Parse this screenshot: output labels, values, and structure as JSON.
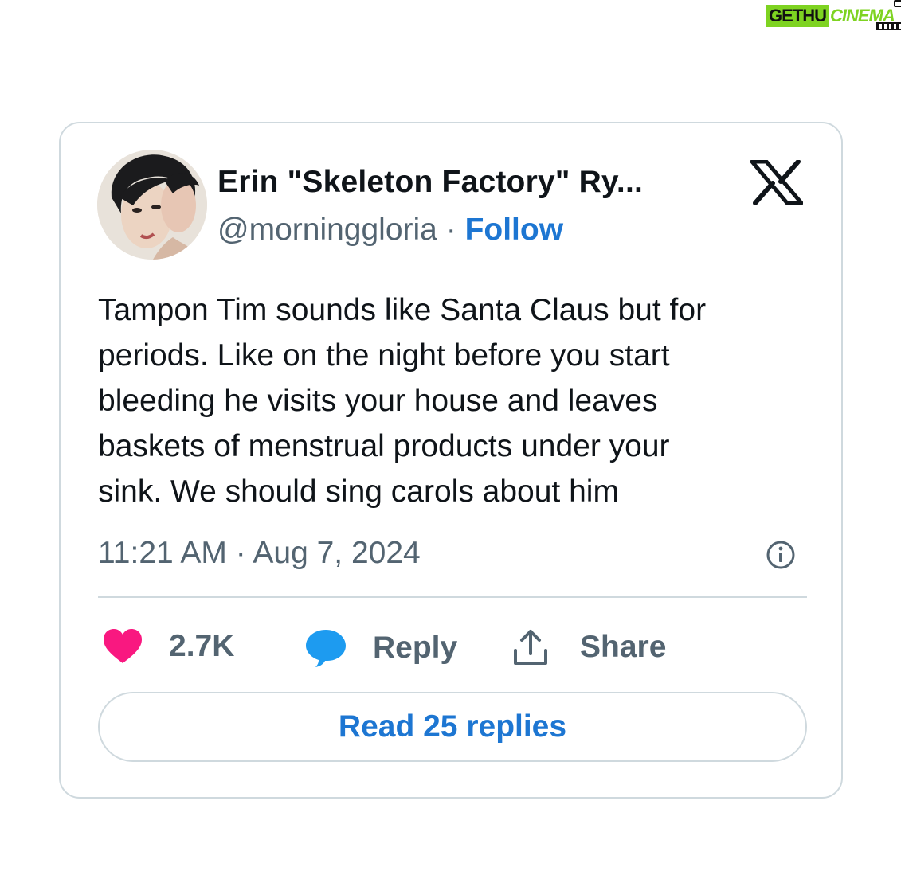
{
  "watermark": {
    "left": "GETHU",
    "right": "CINEMA"
  },
  "tweet": {
    "display_name": "Erin \"Skeleton Factory\" Ry...",
    "handle": "@morninggloria",
    "separator": " · ",
    "follow_label": "Follow",
    "text": "Tampon Tim sounds like Santa Claus but for\nperiods. Like on the night before you start\nbleeding he visits your house and leaves\nbaskets of menstrual products under your\nsink. We should sing carols about him",
    "timestamp": "11:21 AM · Aug 7, 2024"
  },
  "actions": {
    "likes": "2.7K",
    "reply_label": "Reply",
    "share_label": "Share"
  },
  "read_replies_label": "Read 25 replies",
  "colors": {
    "like": "#f91880",
    "reply": "#1d9bf0",
    "link": "#1d76d2",
    "muted": "#536471",
    "border": "#cfd9de"
  },
  "icons": [
    "x-logo-icon",
    "info-icon",
    "heart-icon",
    "speech-bubble-icon",
    "share-upload-icon"
  ]
}
